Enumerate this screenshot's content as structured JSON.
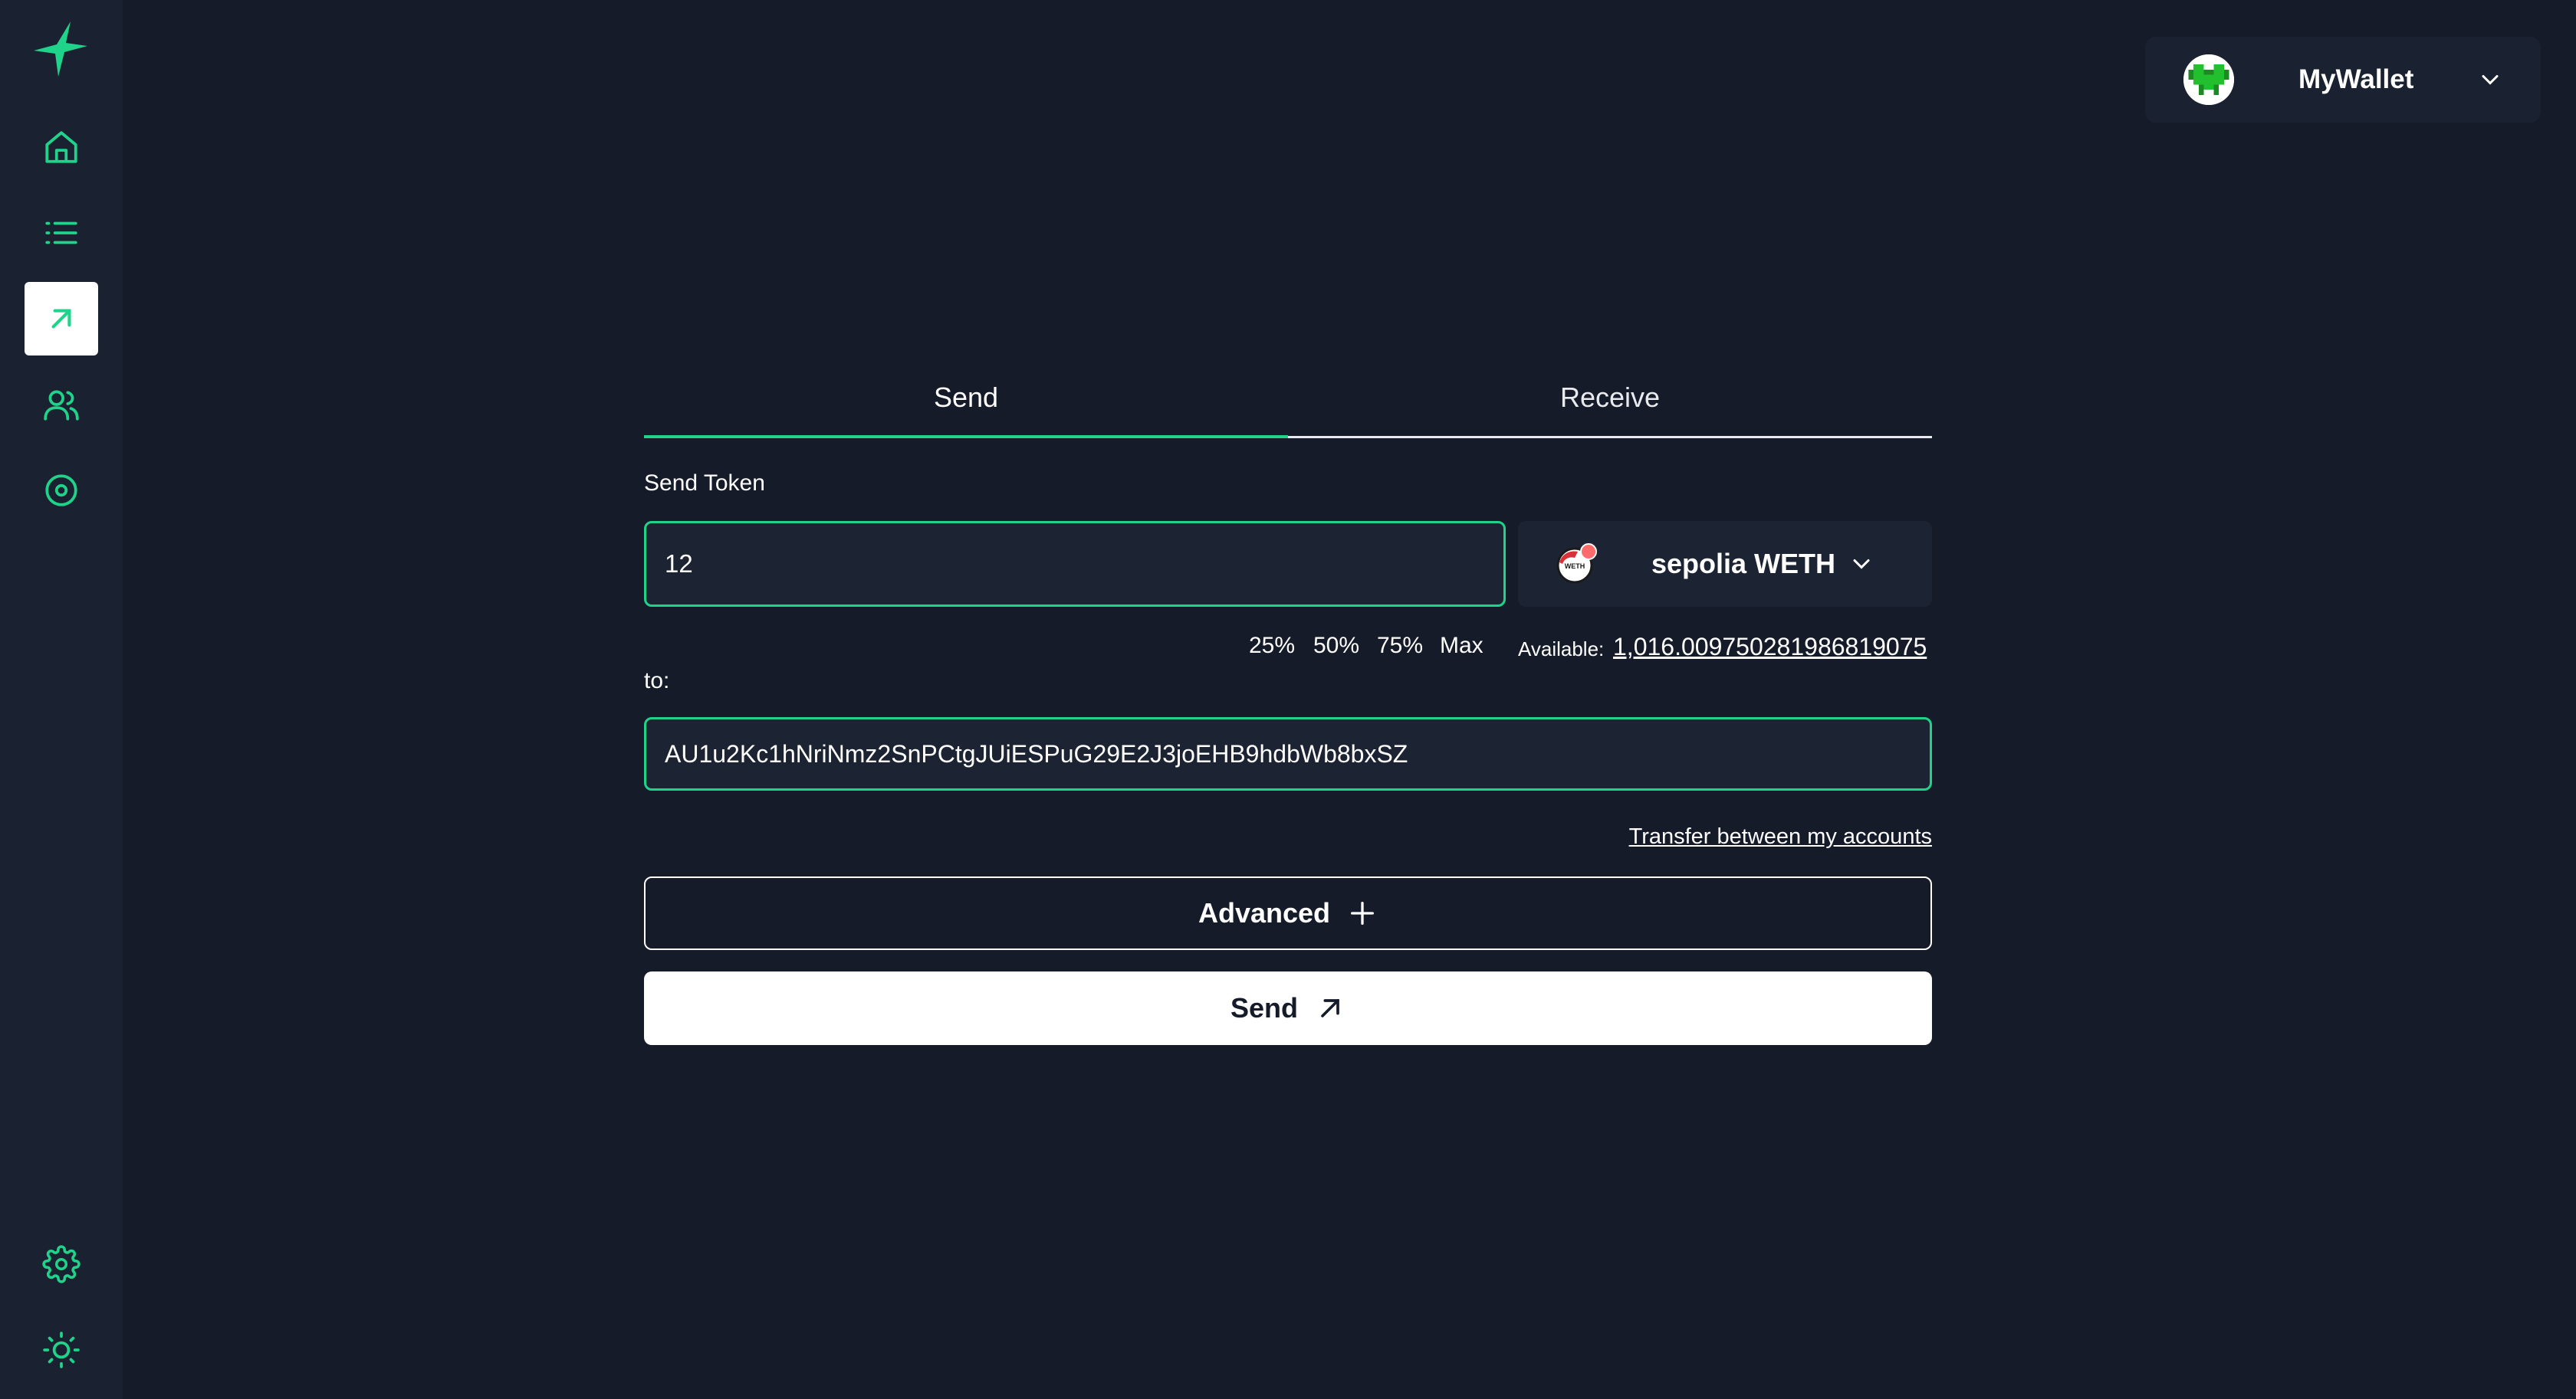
{
  "sidebar": {
    "items": [
      {
        "icon": "home-icon"
      },
      {
        "icon": "list-icon"
      },
      {
        "icon": "send-arrow-icon",
        "active": true
      },
      {
        "icon": "contacts-icon"
      },
      {
        "icon": "target-icon"
      }
    ],
    "bottom": [
      {
        "icon": "gear-icon"
      },
      {
        "icon": "sun-icon"
      }
    ]
  },
  "wallet": {
    "name": "MyWallet"
  },
  "tabs": {
    "send": "Send",
    "receive": "Receive"
  },
  "form": {
    "send_token_label": "Send Token",
    "amount_value": "12",
    "token_name": "sepolia WETH",
    "percentages": [
      "25%",
      "50%",
      "75%",
      "Max"
    ],
    "available_label": "Available:",
    "available_value": "1,016.009750281986819075",
    "to_label": "to:",
    "address_value": "AU1u2Kc1hNriNmz2SnPCtgJUiESPuG29E2J3joEHB9hdbWb8bxSZ",
    "transfer_link": "Transfer between my accounts",
    "advanced_label": "Advanced",
    "send_label": "Send"
  },
  "colors": {
    "accent": "#1fd38b",
    "background": "#151b29",
    "sidebar": "#1a2231"
  }
}
